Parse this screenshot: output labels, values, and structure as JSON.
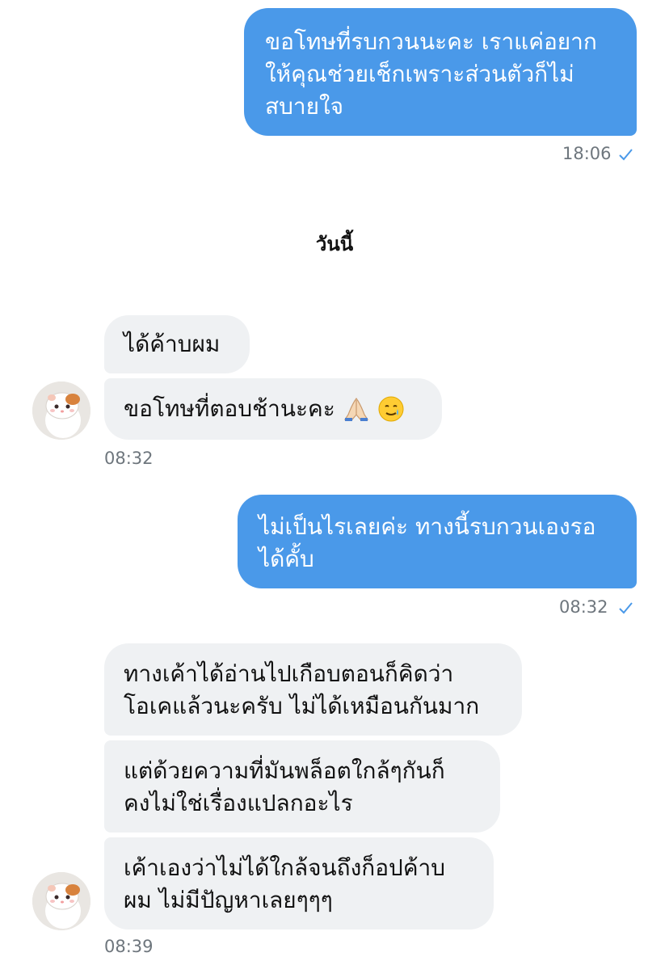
{
  "messages": [
    {
      "direction": "outgoing",
      "lines": [
        "ขอโทษที่รบกวนนะคะ เราแค่อยาก",
        "ให้คุณช่วยเช็กเพราะส่วนตัวก็ไม่",
        "สบายใจ"
      ],
      "time": "18:06",
      "status": "sent"
    },
    {
      "separator": "วันนี้"
    },
    {
      "direction": "incoming",
      "bubbles": [
        {
          "lines": [
            "ได้ค้าบผม"
          ]
        },
        {
          "lines": [
            "ขอโทษที่ตอบช้านะคะ"
          ],
          "emojis": [
            "folded-hands",
            "smiling-face-with-tear"
          ]
        }
      ],
      "time": "08:32"
    },
    {
      "direction": "outgoing",
      "lines": [
        "ไม่เป็นไรเลยค่ะ ทางนี้รบกวนเองรอ",
        "ได้คั้บ"
      ],
      "time": "08:32",
      "status": "sent"
    },
    {
      "direction": "incoming",
      "bubbles": [
        {
          "lines": [
            "ทางเค้าได้อ่านไปเกือบตอนก็คิดว่า",
            "โอเคแล้วนะครับ ไม่ได้เหมือนกันมาก"
          ]
        },
        {
          "lines": [
            "แต่ด้วยความที่มันพล็อตใกล้ๆกันก็",
            "คงไม่ใช่เรื่องแปลกอะไร"
          ]
        },
        {
          "lines": [
            "เค้าเองว่าไม่ได้ใกล้จนถึงก็อปค้าบ",
            "ผม ไม่มีปัญหาเลยๆๆๆ"
          ]
        }
      ],
      "time": "08:39"
    }
  ],
  "colors": {
    "outgoing_bubble": "#4a99e9",
    "incoming_bubble": "#eff1f3",
    "timestamp": "#6e767d",
    "check": "#4a99e9"
  },
  "icons": [
    "check-icon",
    "avatar-hamster",
    "folded-hands-emoji",
    "smiling-face-with-tear-emoji"
  ]
}
